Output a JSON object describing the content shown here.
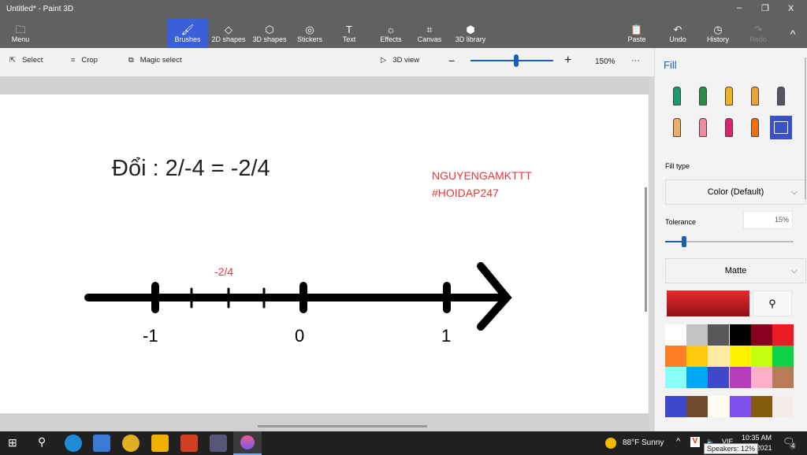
{
  "window": {
    "title": "Untitled* - Paint 3D",
    "min": "–",
    "max": "❐",
    "close": "X"
  },
  "ribbon": {
    "menu": "Menu",
    "tabs": [
      {
        "label": "Brushes",
        "icon": "brush-icon",
        "glyph": "🖌"
      },
      {
        "label": "2D shapes",
        "icon": "2d-shapes-icon",
        "glyph": "◇"
      },
      {
        "label": "3D shapes",
        "icon": "3d-shapes-icon",
        "glyph": "⬡"
      },
      {
        "label": "Stickers",
        "icon": "stickers-icon",
        "glyph": "◎"
      },
      {
        "label": "Text",
        "icon": "text-icon",
        "glyph": "T"
      },
      {
        "label": "Effects",
        "icon": "effects-icon",
        "glyph": "☼"
      },
      {
        "label": "Canvas",
        "icon": "canvas-icon",
        "glyph": "⌗"
      },
      {
        "label": "3D library",
        "icon": "3d-library-icon",
        "glyph": "⬢"
      }
    ],
    "paste": "Paste",
    "undo": "Undo",
    "history": "History",
    "redo": "Redo",
    "collapse": "^"
  },
  "toolbar": {
    "select": "Select",
    "crop": "Crop",
    "magic_select": "Magic select",
    "view3d": "3D view",
    "zoom": "150%",
    "zoom_level": 0.55,
    "more": "···"
  },
  "canvas": {
    "title": "Đổi : 2/-4 = -2/4",
    "watermark1": "NGUYENGAMKTTT",
    "watermark2": "#HOIDAP247",
    "mark_label": "-2/4",
    "labels": [
      "-1",
      "0",
      "1"
    ],
    "red": "#e8383c"
  },
  "panel": {
    "title": "Fill",
    "fill_type_label": "Fill type",
    "fill_type": "Color (Default)",
    "tolerance_label": "Tolerance",
    "tolerance": "15%",
    "tolerance_value": 15,
    "finish": "Matte",
    "current_color": "#c8202a",
    "palette": [
      "#ffffff",
      "#c3c3c3",
      "#585858",
      "#000000",
      "#88001b",
      "#ec1c24",
      "#ff7f27",
      "#ffc90e",
      "#fdeca6",
      "#fff200",
      "#c4ff0e",
      "#0ed145",
      "#8cfffb",
      "#00a8f3",
      "#3f48cc",
      "#b83dba",
      "#ffaec8",
      "#b97a56"
    ],
    "custom": [
      "#3f48cc",
      "#6e4a2e",
      "#fffcf0",
      "#7f4ff0",
      "#845a10",
      "#f5ece8"
    ]
  },
  "taskbar": {
    "weather": "88°F  Sunny",
    "time": "10:35 AM",
    "date": "/2021",
    "lang": "VIE",
    "tooltip": "Speakers: 12%",
    "notifications": "4"
  }
}
